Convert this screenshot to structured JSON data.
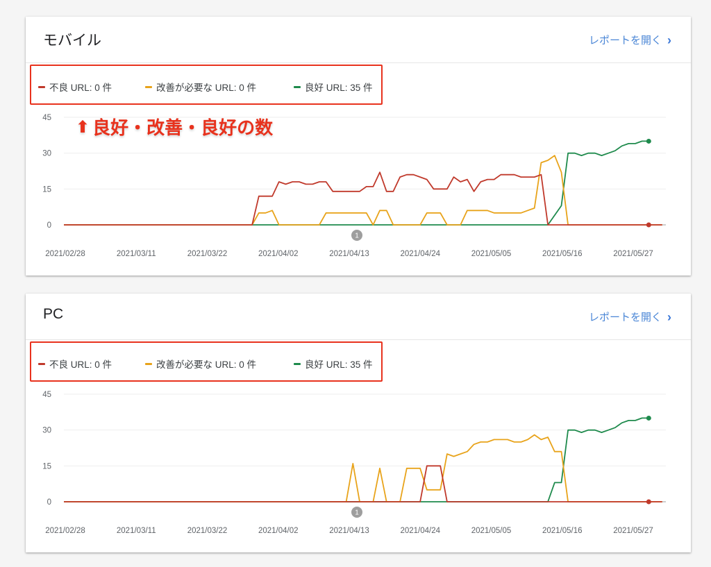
{
  "colors": {
    "poor": "#c0392b",
    "needs_improvement": "#e8a31a",
    "good": "#1e8a4c",
    "annotation": "#e8321d",
    "link": "#4a86d6"
  },
  "sections": [
    {
      "id": "mobile",
      "title": "モバイル",
      "open_report": "レポートを開く",
      "legend": [
        {
          "key": "poor",
          "label": "不良 URL: 0 件"
        },
        {
          "key": "needs_improvement",
          "label": "改善が必要な URL: 0 件"
        },
        {
          "key": "good",
          "label": "良好 URL: 35 件"
        }
      ],
      "annotation": "良好・改善・良好の数",
      "marker": "1"
    },
    {
      "id": "pc",
      "title": "PC",
      "open_report": "レポートを開く",
      "legend": [
        {
          "key": "poor",
          "label": "不良 URL: 0 件"
        },
        {
          "key": "needs_improvement",
          "label": "改善が必要な URL: 0 件"
        },
        {
          "key": "good",
          "label": "良好 URL: 35 件"
        }
      ],
      "annotation": "",
      "marker": "1"
    }
  ],
  "chart_data": [
    {
      "type": "line",
      "x_ticks": [
        "2021/02/28",
        "2021/03/11",
        "2021/03/22",
        "2021/04/02",
        "2021/04/13",
        "2021/04/24",
        "2021/05/05",
        "2021/05/16",
        "2021/05/27"
      ],
      "y_ticks": [
        0,
        15,
        30,
        45
      ],
      "ylim": [
        0,
        45
      ],
      "xlim": [
        "2021/02/28",
        "2021/05/27"
      ],
      "grid": true,
      "series": [
        {
          "key": "poor",
          "values": [
            [
              0,
              0
            ],
            [
              28,
              0
            ],
            [
              29,
              12
            ],
            [
              31,
              12
            ],
            [
              32,
              18
            ],
            [
              33,
              17
            ],
            [
              34,
              18
            ],
            [
              35,
              18
            ],
            [
              36,
              17
            ],
            [
              37,
              17
            ],
            [
              38,
              18
            ],
            [
              39,
              18
            ],
            [
              40,
              14
            ],
            [
              44,
              14
            ],
            [
              45,
              16
            ],
            [
              46,
              16
            ],
            [
              47,
              22
            ],
            [
              48,
              14
            ],
            [
              49,
              14
            ],
            [
              50,
              20
            ],
            [
              51,
              21
            ],
            [
              52,
              21
            ],
            [
              53,
              20
            ],
            [
              54,
              19
            ],
            [
              55,
              15
            ],
            [
              57,
              15
            ],
            [
              58,
              20
            ],
            [
              59,
              18
            ],
            [
              60,
              19
            ],
            [
              61,
              14
            ],
            [
              62,
              18
            ],
            [
              63,
              19
            ],
            [
              64,
              19
            ],
            [
              65,
              21
            ],
            [
              67,
              21
            ],
            [
              68,
              20
            ],
            [
              70,
              20
            ],
            [
              71,
              21
            ],
            [
              72,
              0
            ],
            [
              89,
              0
            ]
          ]
        },
        {
          "key": "needs_improvement",
          "values": [
            [
              0,
              0
            ],
            [
              28,
              0
            ],
            [
              29,
              5
            ],
            [
              30,
              5
            ],
            [
              31,
              6
            ],
            [
              32,
              0
            ],
            [
              38,
              0
            ],
            [
              39,
              5
            ],
            [
              45,
              5
            ],
            [
              46,
              0
            ],
            [
              47,
              6
            ],
            [
              48,
              6
            ],
            [
              49,
              0
            ],
            [
              53,
              0
            ],
            [
              54,
              5
            ],
            [
              56,
              5
            ],
            [
              57,
              0
            ],
            [
              59,
              0
            ],
            [
              60,
              6
            ],
            [
              63,
              6
            ],
            [
              64,
              5
            ],
            [
              68,
              5
            ],
            [
              69,
              6
            ],
            [
              70,
              7
            ],
            [
              71,
              26
            ],
            [
              72,
              27
            ],
            [
              73,
              29
            ],
            [
              74,
              22
            ],
            [
              75,
              0
            ],
            [
              89,
              0
            ]
          ]
        },
        {
          "key": "good",
          "values": [
            [
              0,
              0
            ],
            [
              72,
              0
            ],
            [
              74,
              8
            ],
            [
              75,
              30
            ],
            [
              76,
              30
            ],
            [
              77,
              29
            ],
            [
              78,
              30
            ],
            [
              79,
              30
            ],
            [
              80,
              29
            ],
            [
              81,
              30
            ],
            [
              82,
              31
            ],
            [
              83,
              33
            ],
            [
              84,
              34
            ],
            [
              85,
              34
            ],
            [
              86,
              35
            ],
            [
              87,
              35
            ]
          ]
        }
      ]
    },
    {
      "type": "line",
      "x_ticks": [
        "2021/02/28",
        "2021/03/11",
        "2021/03/22",
        "2021/04/02",
        "2021/04/13",
        "2021/04/24",
        "2021/05/05",
        "2021/05/16",
        "2021/05/27"
      ],
      "y_ticks": [
        0,
        15,
        30,
        45
      ],
      "ylim": [
        0,
        45
      ],
      "xlim": [
        "2021/02/28",
        "2021/05/27"
      ],
      "grid": true,
      "series": [
        {
          "key": "poor",
          "values": [
            [
              0,
              0
            ],
            [
              53,
              0
            ],
            [
              54,
              15
            ],
            [
              56,
              15
            ],
            [
              57,
              0
            ],
            [
              89,
              0
            ]
          ]
        },
        {
          "key": "needs_improvement",
          "values": [
            [
              0,
              0
            ],
            [
              42,
              0
            ],
            [
              43,
              16
            ],
            [
              44,
              0
            ],
            [
              46,
              0
            ],
            [
              47,
              14
            ],
            [
              48,
              0
            ],
            [
              50,
              0
            ],
            [
              51,
              14
            ],
            [
              53,
              14
            ],
            [
              54,
              5
            ],
            [
              56,
              5
            ],
            [
              57,
              20
            ],
            [
              58,
              19
            ],
            [
              59,
              20
            ],
            [
              60,
              21
            ],
            [
              61,
              24
            ],
            [
              62,
              25
            ],
            [
              63,
              25
            ],
            [
              64,
              26
            ],
            [
              66,
              26
            ],
            [
              67,
              25
            ],
            [
              68,
              25
            ],
            [
              69,
              26
            ],
            [
              70,
              28
            ],
            [
              71,
              26
            ],
            [
              72,
              27
            ],
            [
              73,
              21
            ],
            [
              74,
              21
            ],
            [
              75,
              0
            ],
            [
              89,
              0
            ]
          ]
        },
        {
          "key": "good",
          "values": [
            [
              0,
              0
            ],
            [
              72,
              0
            ],
            [
              73,
              8
            ],
            [
              74,
              8
            ],
            [
              75,
              30
            ],
            [
              76,
              30
            ],
            [
              77,
              29
            ],
            [
              78,
              30
            ],
            [
              79,
              30
            ],
            [
              80,
              29
            ],
            [
              81,
              30
            ],
            [
              82,
              31
            ],
            [
              83,
              33
            ],
            [
              84,
              34
            ],
            [
              85,
              34
            ],
            [
              86,
              35
            ],
            [
              87,
              35
            ]
          ]
        }
      ]
    }
  ]
}
